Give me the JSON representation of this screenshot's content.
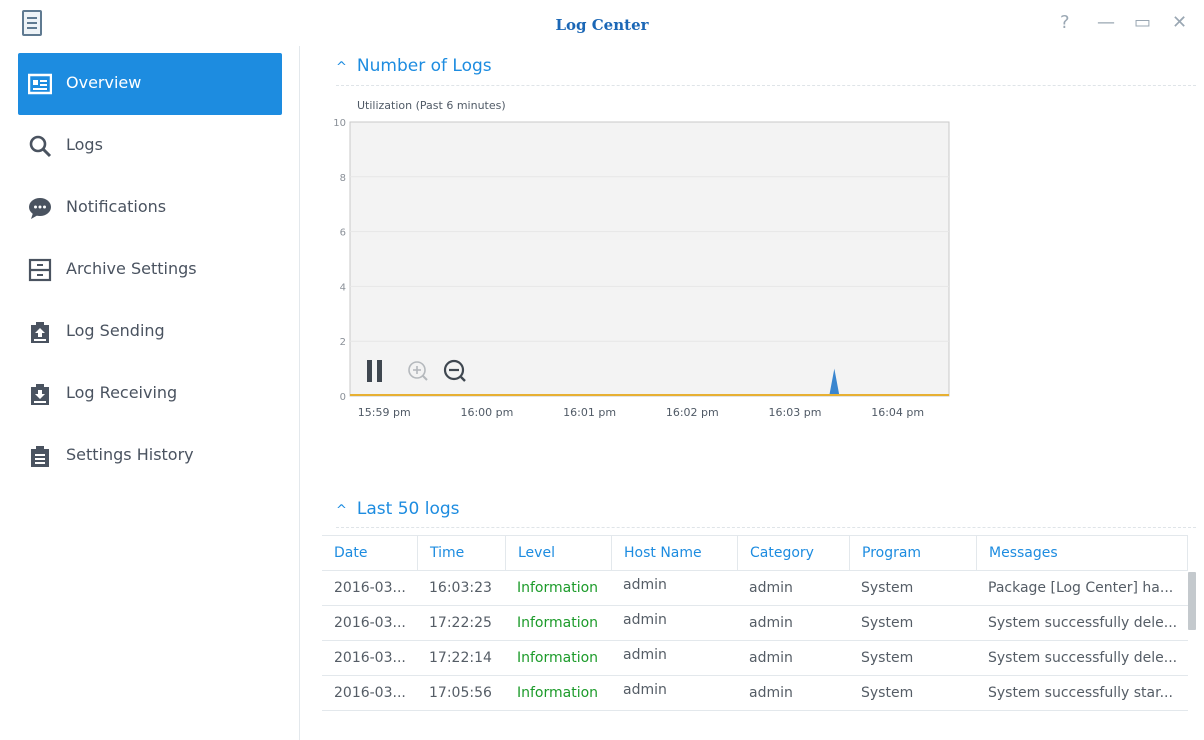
{
  "window": {
    "title": "Log Center",
    "help_glyph": "?",
    "minimize_glyph": "—",
    "maximize_glyph": "▭",
    "close_glyph": "✕"
  },
  "sidebar": {
    "items": [
      {
        "label": "Overview",
        "icon": "overview-icon",
        "active": true
      },
      {
        "label": "Logs",
        "icon": "search-icon",
        "active": false
      },
      {
        "label": "Notifications",
        "icon": "chat-bubble-icon",
        "active": false
      },
      {
        "label": "Archive Settings",
        "icon": "archive-icon",
        "active": false
      },
      {
        "label": "Log Sending",
        "icon": "clipboard-upload-icon",
        "active": false
      },
      {
        "label": "Log Receiving",
        "icon": "clipboard-download-icon",
        "active": false
      },
      {
        "label": "Settings History",
        "icon": "clipboard-list-icon",
        "active": false
      }
    ]
  },
  "number_of_logs": {
    "caret": "^",
    "header": "Number of Logs"
  },
  "chart_data": {
    "type": "area",
    "title": "Utilization (Past 6 minutes)",
    "xlabel": "",
    "ylabel": "",
    "ylim": [
      0,
      10
    ],
    "y_ticks": [
      0,
      2,
      4,
      6,
      8,
      10
    ],
    "x_ticks": [
      "15:59 pm",
      "16:00 pm",
      "16:01 pm",
      "16:02 pm",
      "16:03 pm",
      "16:04 pm"
    ],
    "x": [
      "15:58:40",
      "15:59:30",
      "16:00:30",
      "16:01:30",
      "16:02:30",
      "16:03:20",
      "16:03:23",
      "16:03:26",
      "16:04:10",
      "16:04:30"
    ],
    "values": [
      0,
      0,
      0,
      0,
      0,
      0,
      1,
      0,
      0,
      0
    ],
    "grid": true,
    "colors": {
      "area": "#3a86cf",
      "baseline": "#e7b032",
      "grid": "#e6e6e6",
      "plot_bg": "#f3f3f3"
    },
    "controls": [
      {
        "name": "pause",
        "icon": "pause-icon"
      },
      {
        "name": "zoom-in",
        "icon": "zoom-in-icon"
      },
      {
        "name": "zoom-out",
        "icon": "zoom-out-icon"
      }
    ]
  },
  "last_logs": {
    "caret": "^",
    "header": "Last 50 logs",
    "columns": [
      "Date",
      "Time",
      "Level",
      "Host Name",
      "Category",
      "Program",
      "Messages"
    ],
    "rows": [
      [
        "2016-03...",
        "16:03:23",
        "Information",
        "admin",
        "admin",
        "System",
        "Package [Log Center] ha..."
      ],
      [
        "2016-03...",
        "17:22:25",
        "Information",
        "admin",
        "admin",
        "System",
        "System successfully dele..."
      ],
      [
        "2016-03...",
        "17:22:14",
        "Information",
        "admin",
        "admin",
        "System",
        "System successfully dele..."
      ],
      [
        "2016-03...",
        "17:05:56",
        "Information",
        "admin",
        "admin",
        "System",
        "System successfully star..."
      ]
    ]
  },
  "colors": {
    "accent": "#1d8ce0",
    "title": "#1b67b6",
    "level_information": "#1c9b2a"
  }
}
